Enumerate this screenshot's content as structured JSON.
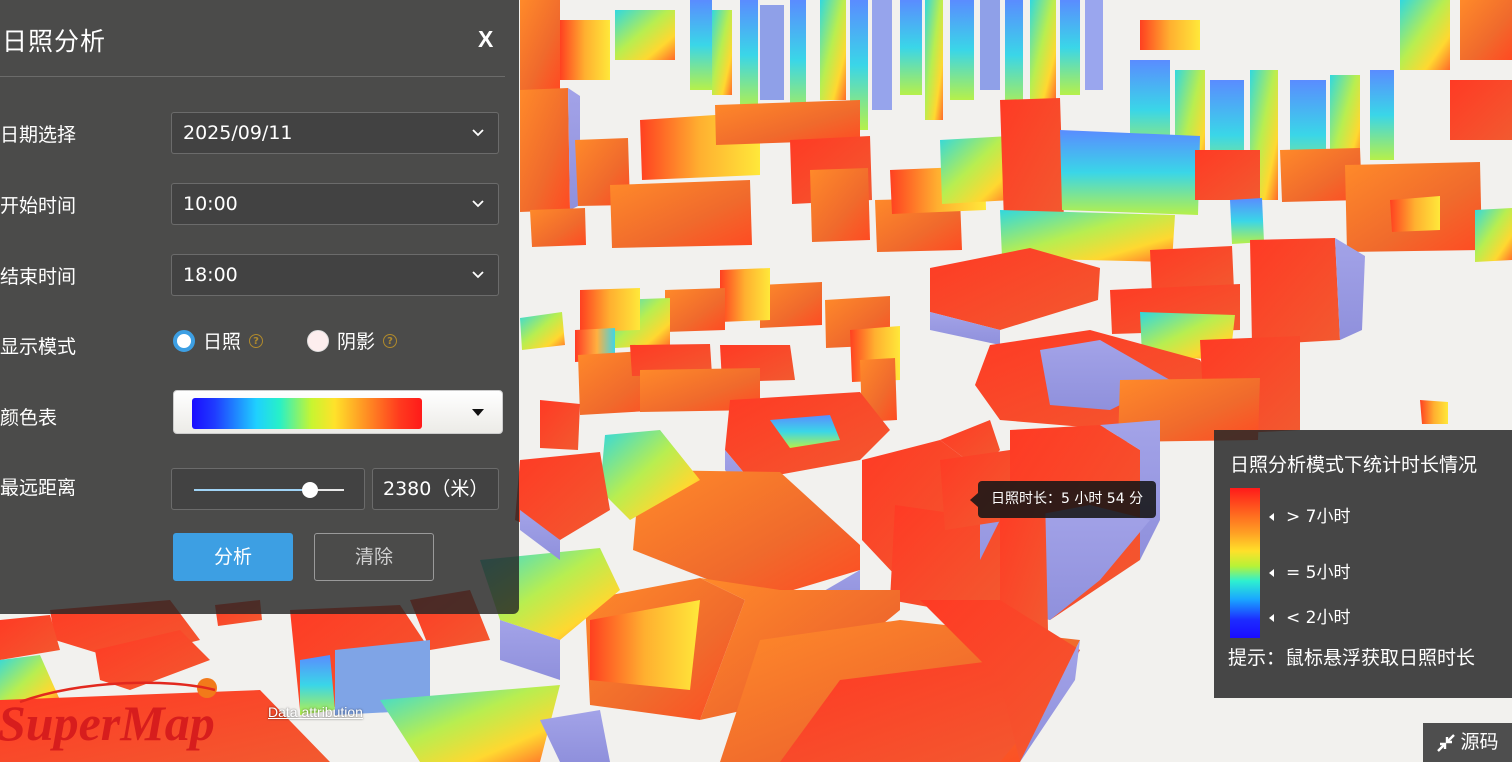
{
  "panel": {
    "title": "日照分析",
    "close_label": "X",
    "date_label": "日期选择",
    "date_value": "2025/09/11",
    "start_label": "开始时间",
    "start_value": "10:00",
    "end_label": "结束时间",
    "end_value": "18:00",
    "mode_label": "显示模式",
    "mode_options": [
      {
        "label": "日照",
        "selected": true
      },
      {
        "label": "阴影",
        "selected": false
      }
    ],
    "color_label": "颜色表",
    "distance_label": "最远距离",
    "distance_value": "2380（米）",
    "distance_slider_fraction": 0.77,
    "analyze_label": "分析",
    "clear_label": "清除"
  },
  "legend": {
    "title": "日照分析模式下统计时长情况",
    "ticks": [
      "> 7小时",
      "= 5小时",
      "< 2小时"
    ],
    "hint": "提示：鼠标悬浮获取日照时长"
  },
  "tooltip": {
    "text": "日照时长：5 小时 54 分"
  },
  "footer": {
    "logo_text": "SuperMap",
    "attribution": "Data attribution",
    "source_label": "源码"
  },
  "colors": {
    "accent": "#3d9fe3",
    "panel_bg": "#262626",
    "ramp": [
      "#1a0cff",
      "#1fd0ff",
      "#c8f530",
      "#ffe22a",
      "#ff9a24",
      "#ff1a1a"
    ]
  }
}
